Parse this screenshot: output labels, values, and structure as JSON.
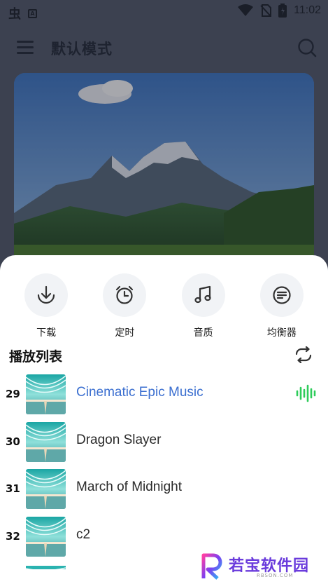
{
  "status_bar": {
    "time": "11:02",
    "app_logo_glyph": "虫",
    "notification_glyph": "A"
  },
  "app_bar": {
    "title": "默认模式",
    "menu_icon": "menu-icon",
    "search_icon": "search-icon"
  },
  "hero": {
    "image": "mountain-landscape-cover"
  },
  "actions": [
    {
      "label": "下载",
      "icon": "download-icon"
    },
    {
      "label": "定时",
      "icon": "alarm-clock-icon"
    },
    {
      "label": "音质",
      "icon": "music-note-icon"
    },
    {
      "label": "均衡器",
      "icon": "equalizer-icon"
    }
  ],
  "playlist": {
    "title": "播放列表",
    "repeat_icon": "repeat-icon",
    "items": [
      {
        "num": "29",
        "title": "Cinematic Epic Music",
        "active": true
      },
      {
        "num": "30",
        "title": "Dragon Slayer",
        "active": false
      },
      {
        "num": "31",
        "title": "March of Midnight",
        "active": false
      },
      {
        "num": "32",
        "title": "c2",
        "active": false
      }
    ]
  },
  "colors": {
    "accent": "#3b6fd0",
    "playing_indicator": "#2ecc5a",
    "overlay": "#3c4150"
  },
  "watermark": {
    "text": "若宝软件园",
    "sub": "RBSON.COM"
  }
}
